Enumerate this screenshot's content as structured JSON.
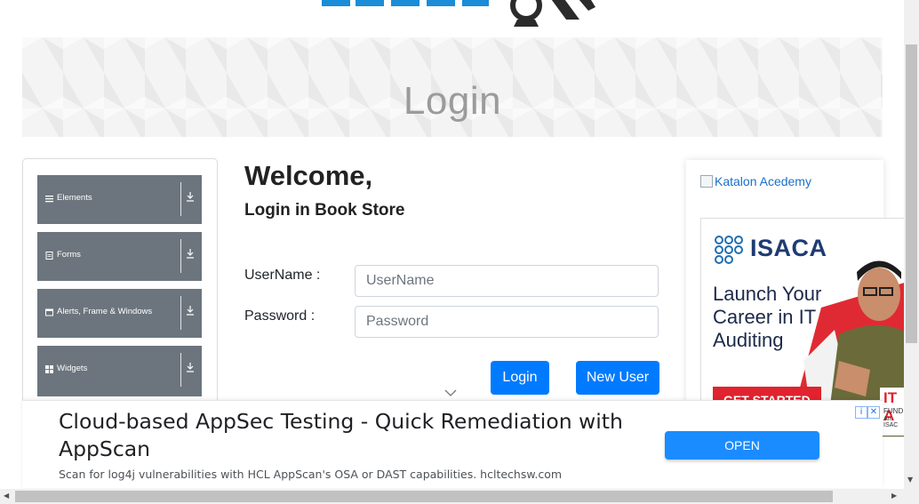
{
  "header": {
    "logo_alt": "TOOLSQA"
  },
  "banner": {
    "title": "Login"
  },
  "sidebar": {
    "groups": [
      {
        "label": "Elements",
        "icon": "list-icon"
      },
      {
        "label": "Forms",
        "icon": "form-icon"
      },
      {
        "label": "Alerts, Frame & Windows",
        "icon": "window-icon"
      },
      {
        "label": "Widgets",
        "icon": "widgets-icon"
      }
    ]
  },
  "login": {
    "heading": "Welcome,",
    "subheading": "Login in Book Store",
    "username_label": "UserName :",
    "username_placeholder": "UserName",
    "username_value": "",
    "password_label": "Password :",
    "password_placeholder": "Password",
    "password_value": "",
    "login_button": "Login",
    "new_user_button": "New User"
  },
  "side_ads": {
    "katalon_alt": "Katalon Acedemy",
    "isaca_brand": "ISACA",
    "isaca_headline": "Launch Your Career in IT Auditing",
    "isaca_cta": "GET STARTED",
    "it_title": "IT A",
    "it_line1": "FUND",
    "it_line2": "An ISAC"
  },
  "bottom_ad": {
    "headline": "Cloud-based AppSec Testing - Quick Remediation with AppScan",
    "description": "Scan for log4j vulnerabilities with HCL AppScan's OSA or DAST capabilities. hcltechsw.com",
    "cta": "OPEN"
  },
  "colors": {
    "primary": "#007bff",
    "sidebar_group": "#6c757d",
    "ad_red": "#e0232e"
  }
}
